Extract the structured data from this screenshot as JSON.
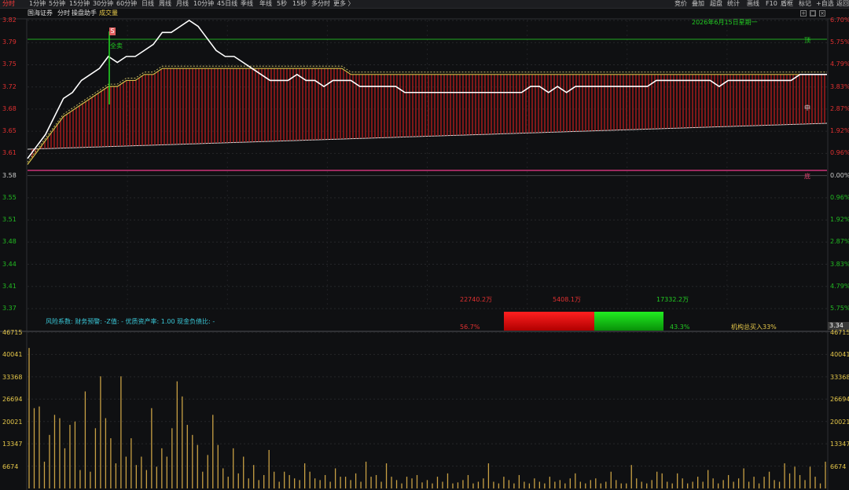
{
  "topbar": {
    "periods": [
      "分时",
      "1分钟",
      "5分钟",
      "15分钟",
      "30分钟",
      "60分钟",
      "日线",
      "周线",
      "月线",
      "10分钟",
      "45日线",
      "季线",
      "年线",
      "5秒",
      "15秒",
      "多分时",
      "更多 〉"
    ],
    "active_period": "分时",
    "tools": [
      "竞价",
      "叠加",
      "超盘",
      "统计",
      "画线",
      "F10",
      "盾框",
      "标记",
      "+自选",
      "返回"
    ]
  },
  "subbar": {
    "stock_name": "国海证券",
    "mode": "分时",
    "helper": "操盘助手",
    "indicator": "成交量",
    "controls": [
      "+",
      "□",
      "×"
    ]
  },
  "chart_date_label": "2026年6月15日星期一",
  "annotations": {
    "sell_marker": "S",
    "sell_text": "全卖",
    "top_marker": "顶",
    "mid_marker": "中",
    "bottom_marker": "底"
  },
  "price_axis_labels": [
    "3.82",
    "3.79",
    "3.75",
    "3.72",
    "3.68",
    "3.65",
    "3.61",
    "3.58",
    "3.55",
    "3.51",
    "3.48",
    "3.44",
    "3.41",
    "3.37"
  ],
  "pct_axis_labels": [
    "6.70%",
    "5.75%",
    "4.79%",
    "3.83%",
    "2.87%",
    "1.92%",
    "0.96%",
    "0.00%",
    "0.96%",
    "1.92%",
    "2.87%",
    "3.83%",
    "4.79%",
    "5.75%"
  ],
  "current_price_tag": "3.34",
  "volume_axis_labels": [
    "46715",
    "40041",
    "33368",
    "26694",
    "20021",
    "13347",
    "6674"
  ],
  "fund_flow": {
    "buy_amount": "22740.2万",
    "net_amount": "5408.1万",
    "sell_amount": "17332.2万",
    "buy_pct": "56.7%",
    "sell_pct": "43.3%",
    "buy_ratio": 0.567,
    "institution_text": "机构总买入33%"
  },
  "info_line": "风险系数: 财务预警: -Z值: - 优质资产率: 1.00 现金负债比: -",
  "colors": {
    "bg": "#0f1012",
    "up_red": "#e03030",
    "down_green": "#10c010",
    "price_line": "#ffffff",
    "avg_line": "#d4c04a",
    "volume_bar": "#c8a044",
    "top_line": "#22aa22",
    "bottom_line": "#cc3377"
  },
  "chart_data": {
    "type": "line",
    "title": "",
    "price_ylim": [
      3.34,
      3.82
    ],
    "pct_ylim": [
      -6.7,
      6.7
    ],
    "price_series": [
      3.59,
      3.61,
      3.63,
      3.66,
      3.69,
      3.7,
      3.72,
      3.73,
      3.74,
      3.76,
      3.75,
      3.76,
      3.76,
      3.77,
      3.78,
      3.8,
      3.8,
      3.81,
      3.82,
      3.81,
      3.79,
      3.77,
      3.76,
      3.76,
      3.75,
      3.74,
      3.73,
      3.72,
      3.72,
      3.72,
      3.73,
      3.72,
      3.72,
      3.71,
      3.72,
      3.72,
      3.72,
      3.71,
      3.71,
      3.71,
      3.71,
      3.71,
      3.7,
      3.7,
      3.7,
      3.7,
      3.7,
      3.7,
      3.7,
      3.7,
      3.7,
      3.7,
      3.7,
      3.7,
      3.7,
      3.7,
      3.71,
      3.71,
      3.7,
      3.71,
      3.7,
      3.71,
      3.71,
      3.71,
      3.71,
      3.71,
      3.71,
      3.71,
      3.71,
      3.71,
      3.72,
      3.72,
      3.72,
      3.72,
      3.72,
      3.72,
      3.72,
      3.71,
      3.72,
      3.72,
      3.72,
      3.72,
      3.72,
      3.72,
      3.72,
      3.72,
      3.73,
      3.73,
      3.73,
      3.73
    ],
    "avg_series": [
      3.58,
      3.6,
      3.62,
      3.64,
      3.66,
      3.67,
      3.68,
      3.69,
      3.7,
      3.71,
      3.71,
      3.72,
      3.72,
      3.73,
      3.73,
      3.74,
      3.74,
      3.74,
      3.74,
      3.74,
      3.74,
      3.74,
      3.74,
      3.74,
      3.74,
      3.74,
      3.74,
      3.74,
      3.74,
      3.74,
      3.74,
      3.74,
      3.74,
      3.74,
      3.74,
      3.74,
      3.73,
      3.73,
      3.73,
      3.73,
      3.73,
      3.73,
      3.73,
      3.73,
      3.73,
      3.73,
      3.73,
      3.73,
      3.73,
      3.73,
      3.73,
      3.73,
      3.73,
      3.73,
      3.73,
      3.73,
      3.73,
      3.73,
      3.73,
      3.73,
      3.73,
      3.73,
      3.73,
      3.73,
      3.73,
      3.73,
      3.73,
      3.73,
      3.73,
      3.73,
      3.73,
      3.73,
      3.73,
      3.73,
      3.73,
      3.73,
      3.73,
      3.73,
      3.73,
      3.73,
      3.73,
      3.73,
      3.73,
      3.73,
      3.73,
      3.73,
      3.73,
      3.73,
      3.73,
      3.73
    ],
    "volume_ylim": [
      0,
      46715
    ],
    "volume_series": [
      42000,
      24000,
      24500,
      8000,
      16000,
      22000,
      21000,
      12000,
      19000,
      20000,
      5500,
      29000,
      5000,
      18000,
      33500,
      21000,
      15000,
      7500,
      33500,
      9500,
      15000,
      7000,
      9500,
      5500,
      24000,
      6500,
      12000,
      9500,
      18000,
      32000,
      27500,
      19000,
      16000,
      13000,
      5000,
      10000,
      22000,
      13000,
      6000,
      3500,
      12000,
      4500,
      9500,
      3000,
      7000,
      2500,
      4000,
      11500,
      5000,
      2000,
      5000,
      4000,
      3000,
      2500,
      7500,
      5000,
      3000,
      2500,
      4000,
      2000,
      6000,
      3500,
      3500,
      2500,
      4500,
      2000,
      8000,
      3500,
      4000,
      2000,
      7500,
      3500,
      2500,
      1500,
      3500,
      3000,
      4000,
      1800,
      2500,
      1500,
      3500,
      2000,
      4500,
      1500,
      1800,
      2500,
      4000,
      1500,
      2000,
      3000,
      7500,
      2000,
      1500,
      3500,
      2500,
      1500,
      4000,
      2000,
      1500,
      3000,
      2000,
      1500,
      3500,
      2000,
      2500,
      1500,
      3000,
      4500,
      2000,
      1500,
      2500,
      3000,
      1500,
      2000,
      5000,
      2500,
      1500,
      1500,
      7000,
      3000,
      2000,
      1500,
      2500,
      5000,
      4500,
      2000,
      1500,
      4500,
      3000,
      1500,
      2000,
      3500,
      2000,
      5500,
      3000,
      1500,
      2500,
      4000,
      2000,
      3000,
      6000,
      2000,
      3500,
      1500,
      3500,
      5000,
      2500,
      2000,
      7500,
      4500,
      6500,
      4000,
      2500,
      6500,
      3500,
      1500,
      8000
    ]
  }
}
